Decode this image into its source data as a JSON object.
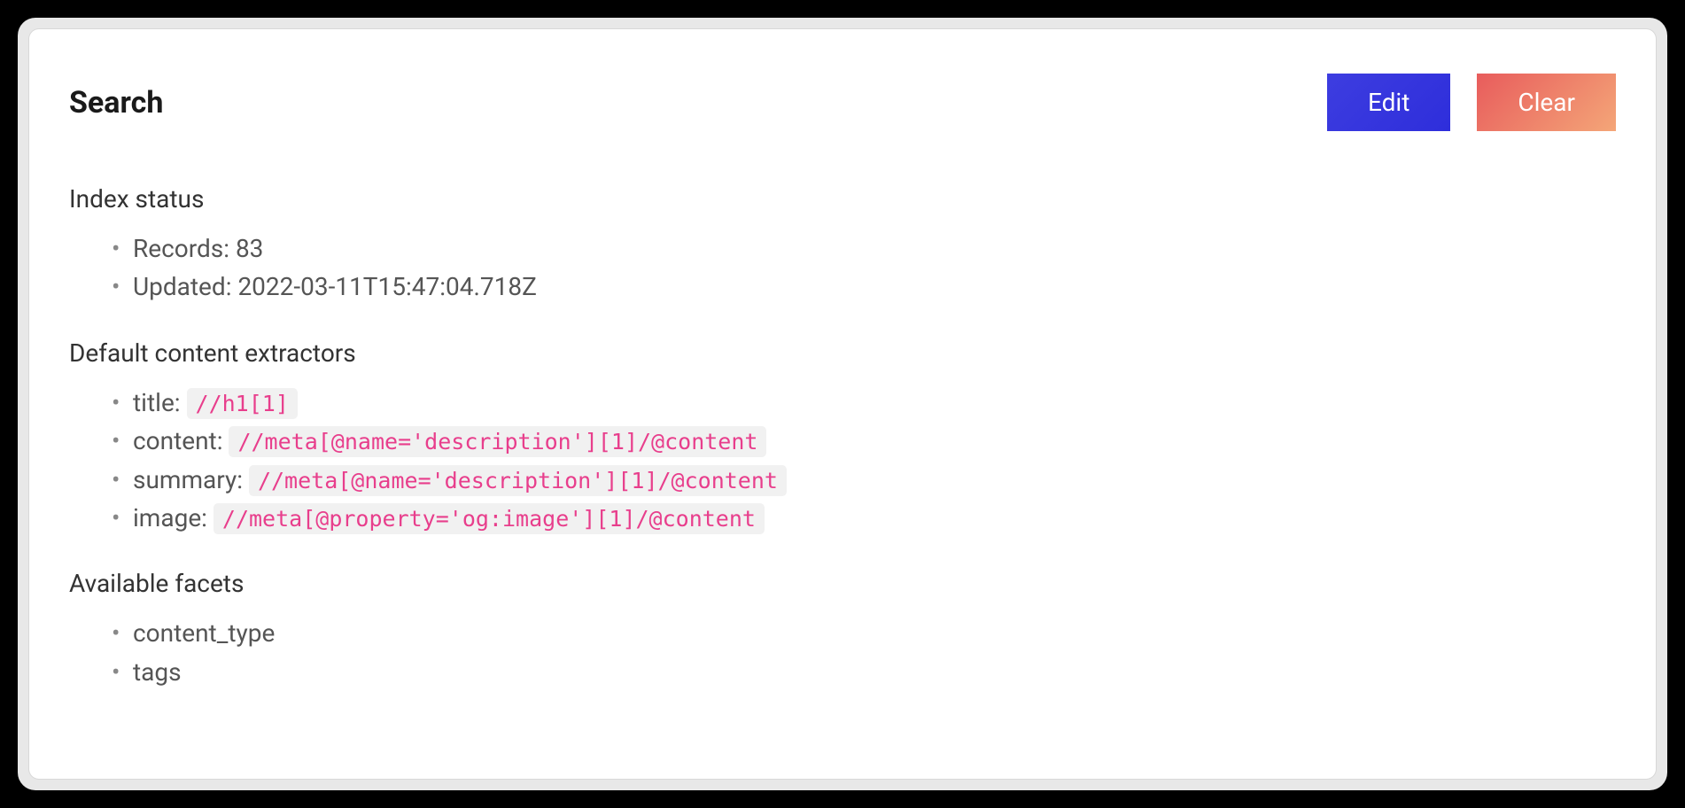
{
  "header": {
    "title": "Search",
    "edit_label": "Edit",
    "clear_label": "Clear"
  },
  "index_status": {
    "heading": "Index status",
    "records_label": "Records:",
    "records_value": "83",
    "updated_label": "Updated:",
    "updated_value": "2022-03-11T15:47:04.718Z"
  },
  "extractors": {
    "heading": "Default content extractors",
    "items": [
      {
        "label": "title:",
        "value": "//h1[1]"
      },
      {
        "label": "content:",
        "value": "//meta[@name='description'][1]/@content"
      },
      {
        "label": "summary:",
        "value": "//meta[@name='description'][1]/@content"
      },
      {
        "label": "image:",
        "value": "//meta[@property='og:image'][1]/@content"
      }
    ]
  },
  "facets": {
    "heading": "Available facets",
    "items": [
      "content_type",
      "tags"
    ]
  }
}
